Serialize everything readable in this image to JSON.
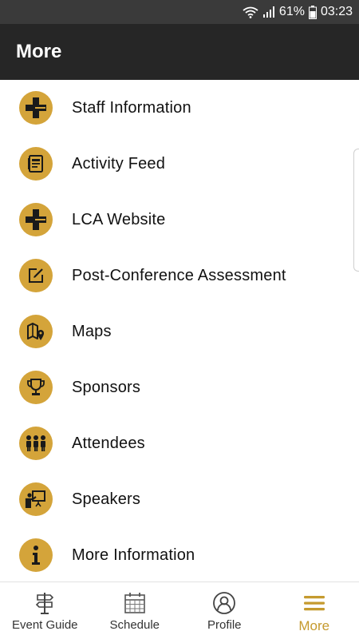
{
  "colors": {
    "accent": "#d4a43a",
    "icon_dark": "#1a1a1a",
    "active_tab": "#c59a2e",
    "app_bar": "#262626",
    "status_bar": "#3a3a3a"
  },
  "status_bar": {
    "battery": "61%",
    "time": "03:23"
  },
  "header": {
    "title": "More"
  },
  "menu": {
    "items": [
      {
        "label": "Staff Information",
        "icon": "plus-cross-icon"
      },
      {
        "label": "Activity Feed",
        "icon": "feed-icon"
      },
      {
        "label": "LCA Website",
        "icon": "plus-cross-icon"
      },
      {
        "label": "Post-Conference Assessment",
        "icon": "edit-square-icon"
      },
      {
        "label": "Maps",
        "icon": "map-pin-icon"
      },
      {
        "label": "Sponsors",
        "icon": "trophy-icon"
      },
      {
        "label": "Attendees",
        "icon": "people-icon"
      },
      {
        "label": "Speakers",
        "icon": "presenter-icon"
      },
      {
        "label": "More Information",
        "icon": "info-icon"
      }
    ]
  },
  "bottom_nav": {
    "tabs": [
      {
        "label": "Event Guide",
        "icon": "signpost-icon",
        "active": false
      },
      {
        "label": "Schedule",
        "icon": "calendar-icon",
        "active": false
      },
      {
        "label": "Profile",
        "icon": "profile-icon",
        "active": false
      },
      {
        "label": "More",
        "icon": "hamburger-icon",
        "active": true
      }
    ]
  }
}
